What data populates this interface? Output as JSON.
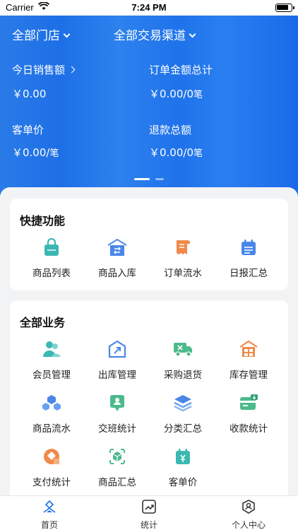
{
  "status_bar": {
    "carrier": "Carrier",
    "time": "7:24 PM"
  },
  "header": {
    "store_filter": "全部门店",
    "channel_filter": "全部交易渠道",
    "metrics": [
      {
        "label": "今日销售额",
        "value": "￥0.00",
        "unit": "",
        "has_arrow": true
      },
      {
        "label": "订单金额总计",
        "value": "￥0.00/0",
        "unit": "笔"
      },
      {
        "label": "客单价",
        "value": "￥0.00/",
        "unit": "笔"
      },
      {
        "label": "退款总额",
        "value": "￥0.00/0",
        "unit": "笔"
      }
    ],
    "carousel": {
      "pages": 2,
      "active_index": 0
    }
  },
  "quick": {
    "title": "快捷功能",
    "items": [
      {
        "label": "商品列表",
        "icon": "bag-icon"
      },
      {
        "label": "商品入库",
        "icon": "warehouse-in-icon"
      },
      {
        "label": "订单流水",
        "icon": "order-receipt-icon"
      },
      {
        "label": "日报汇总",
        "icon": "daily-report-icon"
      }
    ]
  },
  "all": {
    "title": "全部业务",
    "items": [
      {
        "label": "会员管理",
        "icon": "members-icon"
      },
      {
        "label": "出库管理",
        "icon": "warehouse-out-icon"
      },
      {
        "label": "采购退货",
        "icon": "purchase-return-truck-icon"
      },
      {
        "label": "库存管理",
        "icon": "inventory-icon"
      },
      {
        "label": "商品流水",
        "icon": "product-flow-icon"
      },
      {
        "label": "交班统计",
        "icon": "shift-stats-icon"
      },
      {
        "label": "分类汇总",
        "icon": "category-layers-icon"
      },
      {
        "label": "收款统计",
        "icon": "payment-stats-icon"
      },
      {
        "label": "支付统计",
        "icon": "pay-stats-icon"
      },
      {
        "label": "商品汇总",
        "icon": "product-summary-icon"
      },
      {
        "label": "客单价",
        "icon": "unit-price-calendar-icon"
      }
    ]
  },
  "tabbar": {
    "tabs": [
      {
        "label": "首页",
        "icon": "home-icon",
        "active": true
      },
      {
        "label": "统计",
        "icon": "stats-icon",
        "active": false
      },
      {
        "label": "个人中心",
        "icon": "profile-icon",
        "active": false
      }
    ]
  },
  "colors": {
    "header_blue": "#1f72ea",
    "teal": "#3cb8b3",
    "blue": "#4a86e8",
    "orange": "#f08a4b",
    "green": "#4cba8a",
    "background": "#f2f3f5"
  }
}
